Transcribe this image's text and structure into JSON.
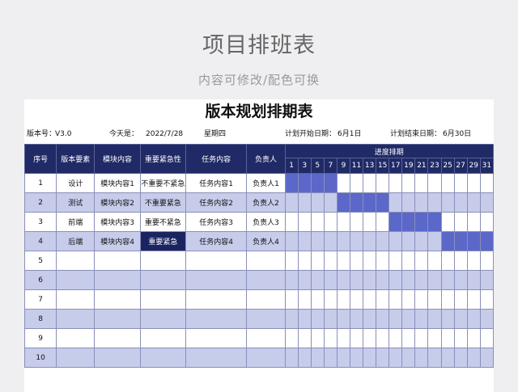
{
  "header": {
    "title": "项目排班表",
    "subtitle": "内容可修改/配色可换"
  },
  "sheet": {
    "title": "版本规划排期表",
    "version_label": "版本号：",
    "version_value": "V3.0",
    "today_label": "今天是：",
    "today_value": "2022/7/28",
    "weekday": "星期四",
    "start_label": "计划开始日期：",
    "start_value": "6月1日",
    "end_label": "计划结束日期：",
    "end_value": "6月30日"
  },
  "table": {
    "columns": [
      "序号",
      "版本要素",
      "模块内容",
      "重要紧急性",
      "任务内容",
      "负责人"
    ],
    "schedule_header": "进度排期",
    "days": [
      "1",
      "3",
      "5",
      "7",
      "9",
      "11",
      "13",
      "15",
      "17",
      "19",
      "21",
      "23",
      "25",
      "27",
      "29",
      "31"
    ],
    "rows": [
      {
        "no": "1",
        "element": "设计",
        "module": "模块内容1",
        "urgency": "不重要不紧急",
        "task": "任务内容1",
        "owner": "负责人1",
        "schedule": [
          1,
          1,
          1,
          1,
          0,
          0,
          0,
          0,
          0,
          0,
          0,
          0,
          0,
          0,
          0,
          0
        ],
        "dark_urgency": false
      },
      {
        "no": "2",
        "element": "测试",
        "module": "模块内容2",
        "urgency": "不重要紧急",
        "task": "任务内容2",
        "owner": "负责人2",
        "schedule": [
          0,
          0,
          0,
          0,
          1,
          1,
          1,
          1,
          0,
          0,
          0,
          0,
          0,
          0,
          0,
          0
        ],
        "dark_urgency": false
      },
      {
        "no": "3",
        "element": "前端",
        "module": "模块内容3",
        "urgency": "重要不紧急",
        "task": "任务内容3",
        "owner": "负责人3",
        "schedule": [
          0,
          0,
          0,
          0,
          0,
          0,
          0,
          0,
          1,
          1,
          1,
          1,
          0,
          0,
          0,
          0
        ],
        "dark_urgency": false
      },
      {
        "no": "4",
        "element": "后端",
        "module": "模块内容4",
        "urgency": "重要紧急",
        "task": "任务内容4",
        "owner": "负责人4",
        "schedule": [
          0,
          0,
          0,
          0,
          0,
          0,
          0,
          0,
          0,
          0,
          0,
          0,
          1,
          1,
          1,
          1
        ],
        "dark_urgency": true
      },
      {
        "no": "5",
        "element": "",
        "module": "",
        "urgency": "",
        "task": "",
        "owner": "",
        "schedule": [
          0,
          0,
          0,
          0,
          0,
          0,
          0,
          0,
          0,
          0,
          0,
          0,
          0,
          0,
          0,
          0
        ],
        "dark_urgency": false
      },
      {
        "no": "6",
        "element": "",
        "module": "",
        "urgency": "",
        "task": "",
        "owner": "",
        "schedule": [
          0,
          0,
          0,
          0,
          0,
          0,
          0,
          0,
          0,
          0,
          0,
          0,
          0,
          0,
          0,
          0
        ],
        "dark_urgency": false
      },
      {
        "no": "7",
        "element": "",
        "module": "",
        "urgency": "",
        "task": "",
        "owner": "",
        "schedule": [
          0,
          0,
          0,
          0,
          0,
          0,
          0,
          0,
          0,
          0,
          0,
          0,
          0,
          0,
          0,
          0
        ],
        "dark_urgency": false
      },
      {
        "no": "8",
        "element": "",
        "module": "",
        "urgency": "",
        "task": "",
        "owner": "",
        "schedule": [
          0,
          0,
          0,
          0,
          0,
          0,
          0,
          0,
          0,
          0,
          0,
          0,
          0,
          0,
          0,
          0
        ],
        "dark_urgency": false
      },
      {
        "no": "9",
        "element": "",
        "module": "",
        "urgency": "",
        "task": "",
        "owner": "",
        "schedule": [
          0,
          0,
          0,
          0,
          0,
          0,
          0,
          0,
          0,
          0,
          0,
          0,
          0,
          0,
          0,
          0
        ],
        "dark_urgency": false
      },
      {
        "no": "10",
        "element": "",
        "module": "",
        "urgency": "",
        "task": "",
        "owner": "",
        "schedule": [
          0,
          0,
          0,
          0,
          0,
          0,
          0,
          0,
          0,
          0,
          0,
          0,
          0,
          0,
          0,
          0
        ],
        "dark_urgency": false
      }
    ]
  },
  "colors": {
    "header_bg": "#1f2a66",
    "alt_row": "#c7cceb",
    "bar_fill": "#5b68c9",
    "urgent_dark": "#1a2460"
  }
}
